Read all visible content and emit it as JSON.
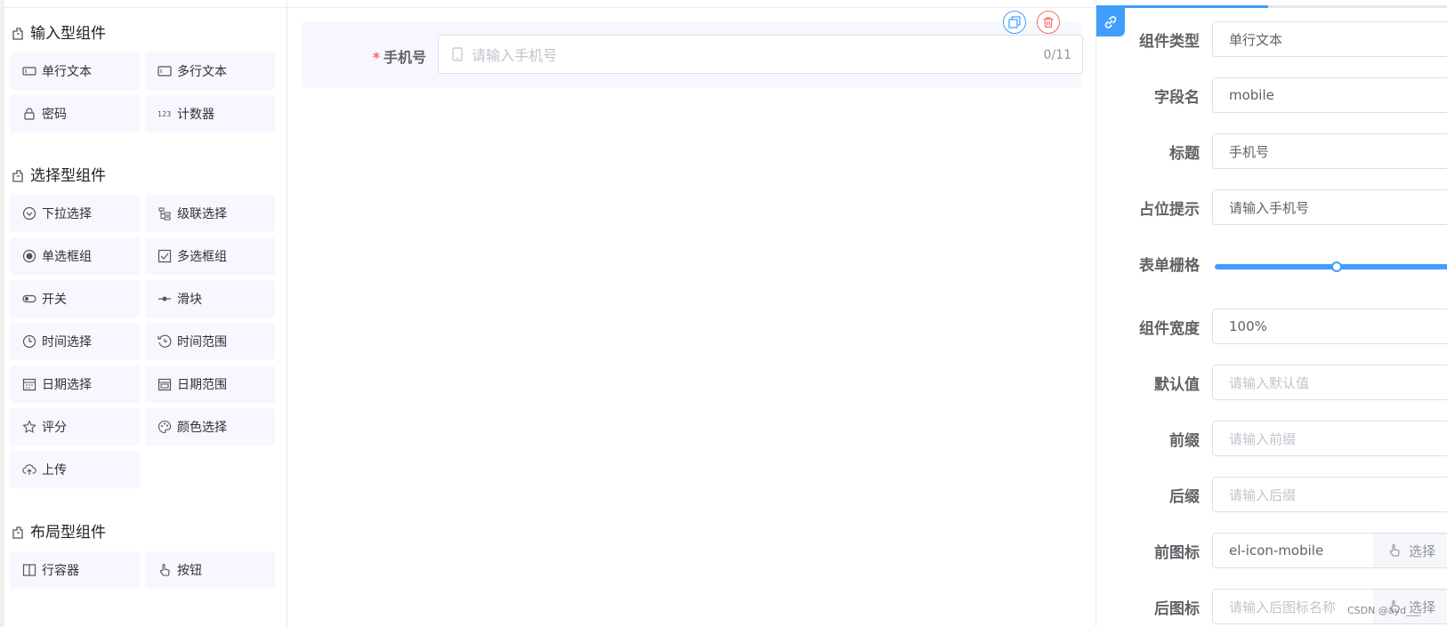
{
  "left_panel": {
    "groups": [
      {
        "title": "输入型组件",
        "items": [
          {
            "label": "单行文本",
            "icon": "input-icon"
          },
          {
            "label": "多行文本",
            "icon": "textarea-icon"
          },
          {
            "label": "密码",
            "icon": "lock-icon"
          },
          {
            "label": "计数器",
            "icon": "number-icon"
          }
        ]
      },
      {
        "title": "选择型组件",
        "items": [
          {
            "label": "下拉选择",
            "icon": "select-icon"
          },
          {
            "label": "级联选择",
            "icon": "cascader-icon"
          },
          {
            "label": "单选框组",
            "icon": "radio-icon"
          },
          {
            "label": "多选框组",
            "icon": "checkbox-icon"
          },
          {
            "label": "开关",
            "icon": "switch-icon"
          },
          {
            "label": "滑块",
            "icon": "slider-icon"
          },
          {
            "label": "时间选择",
            "icon": "clock-icon"
          },
          {
            "label": "时间范围",
            "icon": "time-range-icon"
          },
          {
            "label": "日期选择",
            "icon": "calendar-icon"
          },
          {
            "label": "日期范围",
            "icon": "date-range-icon"
          },
          {
            "label": "评分",
            "icon": "star-icon"
          },
          {
            "label": "颜色选择",
            "icon": "palette-icon"
          },
          {
            "label": "上传",
            "icon": "upload-icon"
          }
        ]
      },
      {
        "title": "布局型组件",
        "items": [
          {
            "label": "行容器",
            "icon": "row-icon"
          },
          {
            "label": "按钮",
            "icon": "hand-pointer-icon"
          }
        ]
      }
    ]
  },
  "canvas": {
    "field": {
      "required_mark": "*",
      "label": "手机号",
      "placeholder": "请输入手机号",
      "counter": "0/11"
    }
  },
  "props": {
    "component_type_label": "组件类型",
    "component_type_value": "单行文本",
    "field_name_label": "字段名",
    "field_name_value": "mobile",
    "title_label": "标题",
    "title_value": "手机号",
    "placeholder_label": "占位提示",
    "placeholder_value": "请输入手机号",
    "span_label": "表单栅格",
    "span_value": 12,
    "span_max": 24,
    "width_label": "组件宽度",
    "width_value": "100%",
    "default_label": "默认值",
    "default_placeholder": "请输入默认值",
    "prefix_label": "前缀",
    "prefix_placeholder": "请输入前缀",
    "suffix_label": "后缀",
    "suffix_placeholder": "请输入后缀",
    "prefix_icon_label": "前图标",
    "prefix_icon_value": "el-icon-mobile",
    "suffix_icon_label": "后图标",
    "suffix_icon_placeholder": "请输入后图标名称",
    "choose_label": "选择"
  },
  "watermark": "CSDN @ayd___",
  "colors": {
    "primary": "#409eff",
    "danger": "#f56c6c",
    "item_bg": "#f6f7ff"
  }
}
